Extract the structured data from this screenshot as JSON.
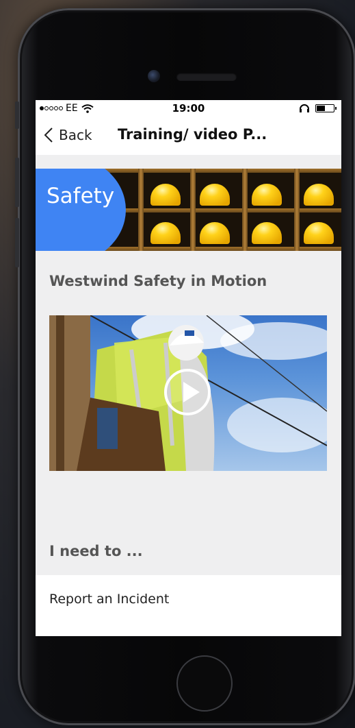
{
  "status_bar": {
    "carrier": "EE",
    "time": "19:00"
  },
  "nav": {
    "back_label": "Back",
    "title": "Training/ video P..."
  },
  "banner": {
    "label": "Safety"
  },
  "section": {
    "title": "Westwind Safety in Motion"
  },
  "video": {
    "play_icon": "play-icon"
  },
  "actions": {
    "title": "I need to ...",
    "items": [
      {
        "label": "Report an Incident"
      }
    ]
  },
  "colors": {
    "accent_blue": "#3f84f3",
    "background": "#efeff0"
  }
}
